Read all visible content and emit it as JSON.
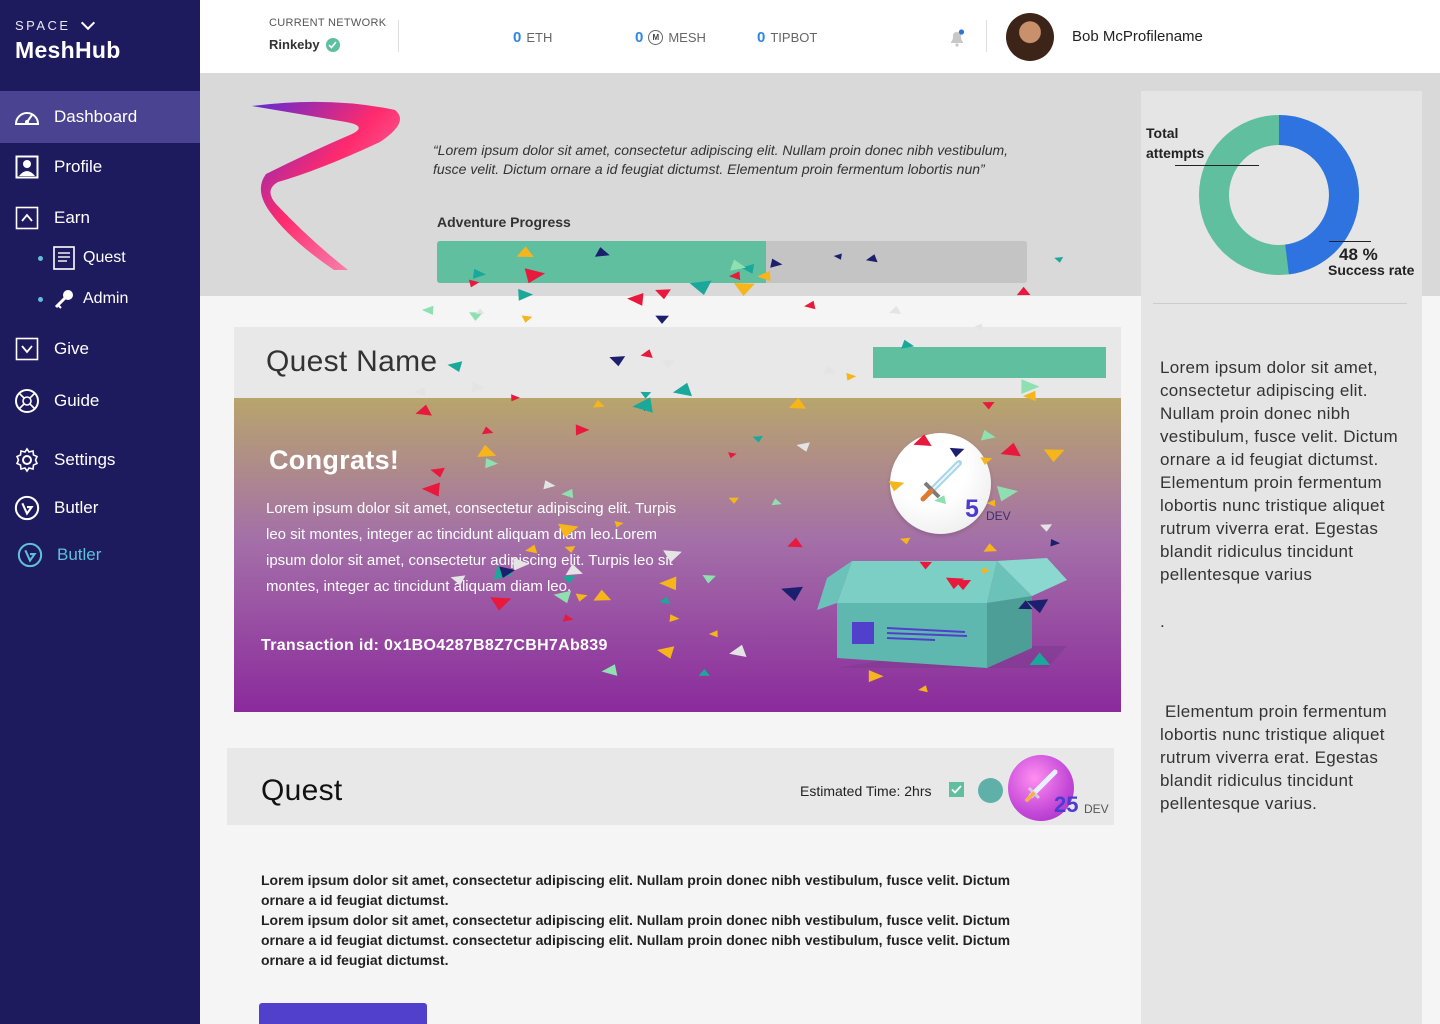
{
  "sidebar": {
    "brand_top": "SPACE",
    "brand_name": "MeshHub",
    "items": [
      {
        "label": "Dashboard"
      },
      {
        "label": "Profile"
      },
      {
        "label": "Earn"
      },
      {
        "label": "Quest"
      },
      {
        "label": "Admin"
      },
      {
        "label": "Give"
      },
      {
        "label": "Guide"
      },
      {
        "label": "Settings"
      },
      {
        "label": "Butler"
      },
      {
        "label": "Butler"
      }
    ]
  },
  "header": {
    "network_label": "CURRENT NETWORK",
    "network_value": "Rinkeby",
    "balances": [
      {
        "amount": "0",
        "unit": "ETH"
      },
      {
        "amount": "0",
        "unit": "MESH",
        "coin": "M"
      },
      {
        "amount": "0",
        "unit": "TIPBOT"
      }
    ],
    "user_name": "Bob McProfilename"
  },
  "hero": {
    "quote": "“Lorem ipsum dolor sit amet, consectetur adipiscing elit. Nullam proin donec nibh vestibulum, fusce velit. Dictum ornare a id feugiat dictumst. Elementum proin fermentum lobortis nun”",
    "progress_label": "Adventure Progress",
    "progress_percent": 55.8
  },
  "stats": {
    "total_label": "Total attempts",
    "success_value": "48 %",
    "success_label": "Success rate",
    "success_fraction": 0.48,
    "colors": {
      "success": "#2f73e0",
      "rest": "#5fbf9f"
    }
  },
  "right_panel": {
    "para1": "Lorem ipsum dolor sit amet, consectetur adipiscing elit. Nullam proin donec nibh vestibulum, fusce velit. Dictum ornare a id feugiat dictumst. Elementum proin fermentum lobortis nunc tristique aliquet rutrum viverra erat. Egestas blandit ridiculus tincidunt pellentesque varius",
    "para1_end": ".",
    "para2": " Elementum proin fermentum lobortis nunc tristique aliquet rutrum viverra erat. Egestas blandit ridiculus tincidunt pellentesque varius."
  },
  "quest_card": {
    "name": "Quest Name",
    "congrats_title": "Congrats!",
    "congrats_body": "Lorem ipsum dolor sit amet, consectetur adipiscing elit. Turpis leo sit montes, integer ac tincidunt aliquam diam leo.Lorem ipsum dolor sit amet, consectetur adipiscing elit. Turpis leo sit montes, integer ac tincidunt aliquam diam leo.",
    "transaction": "Transaction id: 0x1BO4287B8Z7CBH7Ab839",
    "reward_amount": "5",
    "reward_unit": "DEV"
  },
  "quest": {
    "title": "Quest",
    "estimated_time": "Estimated Time: 2hrs",
    "reward_amount": "25",
    "reward_unit": "DEV",
    "body1": "Lorem ipsum dolor sit amet, consectetur adipiscing elit. Nullam proin donec nibh vestibulum, fusce velit. Dictum ornare a id feugiat dictumst.",
    "body2": "Lorem ipsum dolor sit amet, consectetur adipiscing elit. Nullam proin donec nibh vestibulum, fusce velit. Dictum ornare a id feugiat dictumst. consectetur adipiscing elit. Nullam proin donec nibh vestibulum, fusce velit. Dictum ornare a id feugiat dictumst."
  },
  "icons": {
    "dashboard": "speedometer-icon",
    "profile": "user-icon",
    "earn": "chevron-up-box-icon",
    "quest": "document-icon",
    "admin": "key-icon",
    "give": "chevron-down-box-icon",
    "guide": "compass-icon",
    "settings": "gear-icon",
    "butler": "butler-icon",
    "notification": "bell-icon",
    "verified": "check-circle-icon"
  }
}
